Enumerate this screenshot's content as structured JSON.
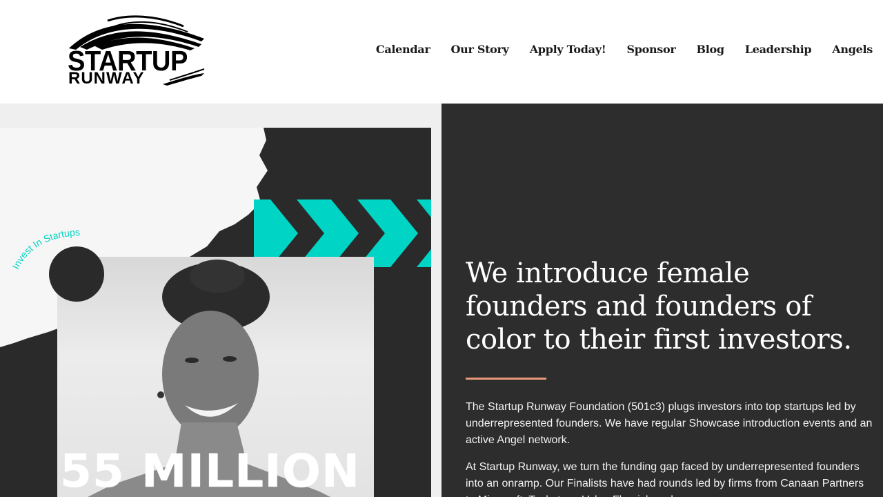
{
  "header": {
    "logo": {
      "line1": "STARTUP",
      "line2": "RUNWAY"
    },
    "nav": [
      {
        "label": "Calendar"
      },
      {
        "label": "Our Story"
      },
      {
        "label": "Apply Today!"
      },
      {
        "label": "Sponsor"
      },
      {
        "label": "Blog"
      },
      {
        "label": "Leadership"
      },
      {
        "label": "Angels"
      }
    ]
  },
  "promo": {
    "arc_text": "Invest In Startups",
    "big_number": "55 MILLION",
    "colors": {
      "accent": "#00d4c4",
      "dark": "#2a2a2a"
    }
  },
  "hero": {
    "headline": "We introduce female founders and founders of color to their first investors.",
    "divider_color": "#e8997a",
    "paragraphs": [
      "The Startup Runway Foundation (501c3) plugs investors into top startups led by underrepresented founders. We have regular Showcase introduction events and an active Angel network.",
      "At Startup Runway, we turn the funding gap faced by underrepresented founders into an onramp. Our Finalists have had rounds led by firms from Canaan Partners to Microsoft, Techstars, Valor, Flourish and more."
    ]
  }
}
